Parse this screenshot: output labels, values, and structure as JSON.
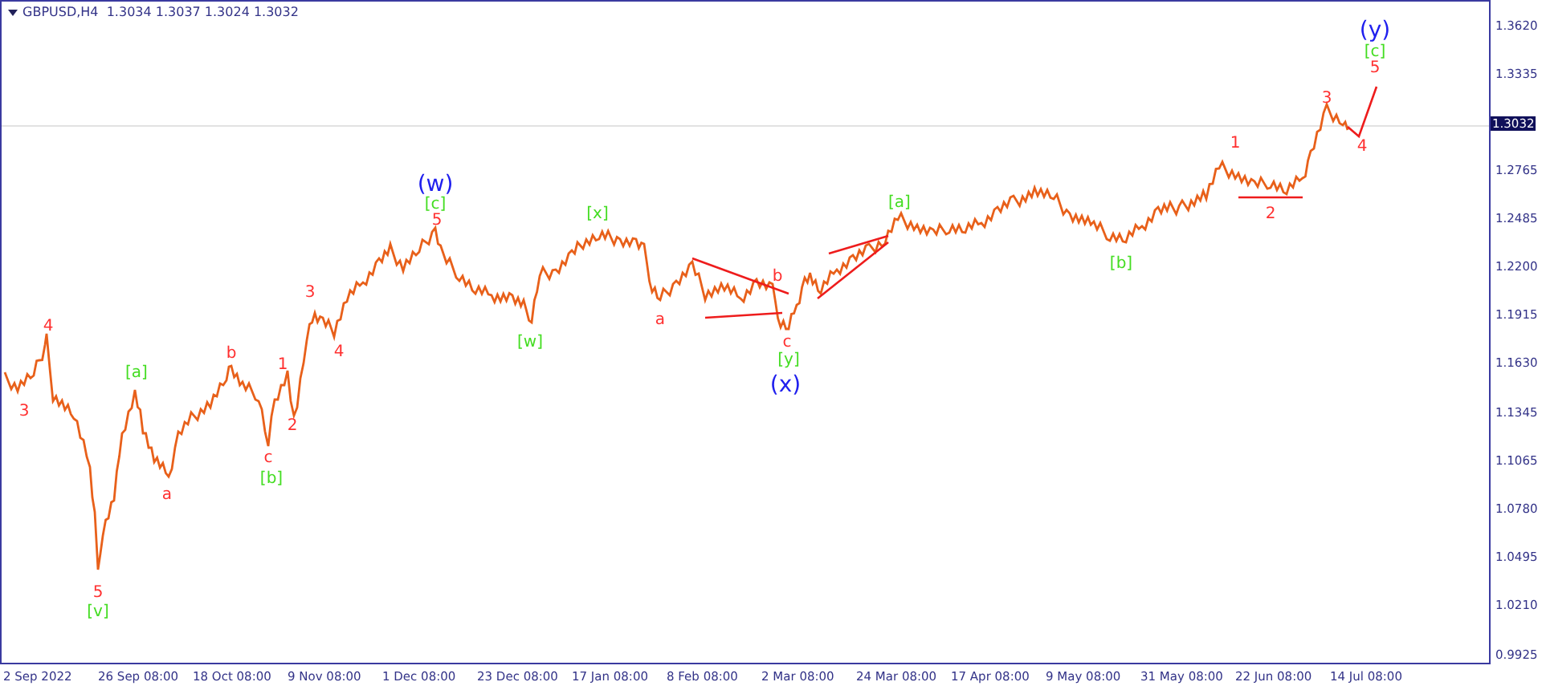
{
  "header": {
    "title": "GBPUSD,H4  1.3034 1.3037 1.3024 1.3032"
  },
  "price_axis": {
    "ticks": [
      "1.3620",
      "1.3335",
      "1.2765",
      "1.2485",
      "1.2200",
      "1.1915",
      "1.1630",
      "1.1345",
      "1.1065",
      "1.0780",
      "1.0495",
      "1.0210",
      "0.9925"
    ],
    "current_price": "1.3032"
  },
  "time_axis": {
    "ticks": [
      "2 Sep 2022",
      "26 Sep 08:00",
      "18 Oct 08:00",
      "9 Nov 08:00",
      "1 Dec 08:00",
      "23 Dec 08:00",
      "17 Jan 08:00",
      "8 Feb 08:00",
      "2 Mar 08:00",
      "24 Mar 08:00",
      "17 Apr 08:00",
      "9 May 08:00",
      "31 May 08:00",
      "22 Jun 08:00",
      "14 Jul 08:00"
    ]
  },
  "wave_labels": [
    {
      "text": "3",
      "color": "#ff3030"
    },
    {
      "text": "4",
      "color": "#ff3030"
    },
    {
      "text": "5",
      "color": "#ff3030"
    },
    {
      "text": "[v]",
      "color": "#44dd22"
    },
    {
      "text": "[a]",
      "color": "#44dd22"
    },
    {
      "text": "a",
      "color": "#ff3030"
    },
    {
      "text": "b",
      "color": "#ff3030"
    },
    {
      "text": "c",
      "color": "#ff3030"
    },
    {
      "text": "[b]",
      "color": "#44dd22"
    },
    {
      "text": "1",
      "color": "#ff3030"
    },
    {
      "text": "2",
      "color": "#ff3030"
    },
    {
      "text": "3",
      "color": "#ff3030"
    },
    {
      "text": "4",
      "color": "#ff3030"
    },
    {
      "text": "(w)",
      "color": "#2020ee"
    },
    {
      "text": "[c]",
      "color": "#44dd22"
    },
    {
      "text": "5",
      "color": "#ff3030"
    },
    {
      "text": "[w]",
      "color": "#44dd22"
    },
    {
      "text": "[x]",
      "color": "#44dd22"
    },
    {
      "text": "a",
      "color": "#ff3030"
    },
    {
      "text": "b",
      "color": "#ff3030"
    },
    {
      "text": "c",
      "color": "#ff3030"
    },
    {
      "text": "[y]",
      "color": "#44dd22"
    },
    {
      "text": "(x)",
      "color": "#2020ee"
    },
    {
      "text": "[a]",
      "color": "#44dd22"
    },
    {
      "text": "[b]",
      "color": "#44dd22"
    },
    {
      "text": "1",
      "color": "#ff3030"
    },
    {
      "text": "2",
      "color": "#ff3030"
    },
    {
      "text": "3",
      "color": "#ff3030"
    },
    {
      "text": "4",
      "color": "#ff3030"
    },
    {
      "text": "(y)",
      "color": "#2020ee"
    },
    {
      "text": "[c]",
      "color": "#44dd22"
    },
    {
      "text": "5",
      "color": "#ff3030"
    }
  ]
}
